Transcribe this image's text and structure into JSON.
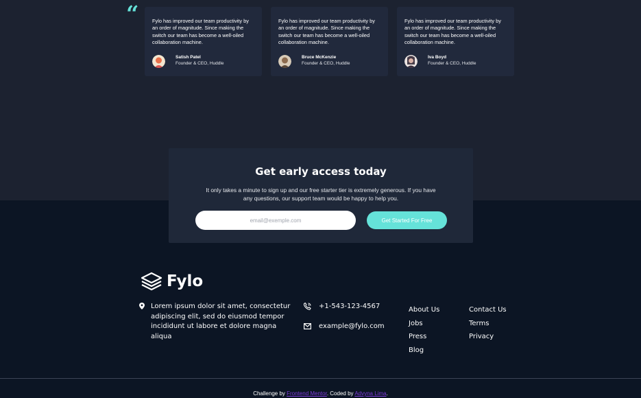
{
  "testimonials": {
    "quote_glyph": "“",
    "cards": [
      {
        "text": "Fylo has improved our team productivity by an order of magnitude. Since making the switch our team has become a well-oiled collaboration machine.",
        "name": "Satish Patel",
        "role": "Founder & CEO, Huddle",
        "avatar_color": "#e8704a"
      },
      {
        "text": "Fylo has improved our team productivity by an order of magnitude. Since making the switch our team has become a well-oiled collaboration machine.",
        "name": "Bruce McKenzie",
        "role": "Founder & CEO, Huddle",
        "avatar_color": "#b08a6a"
      },
      {
        "text": "Fylo has improved our team productivity by an order of magnitude. Since making the switch our team has become a well-oiled collaboration machine.",
        "name": "Iva Boyd",
        "role": "Founder & CEO, Huddle",
        "avatar_color": "#c9a3a8"
      }
    ]
  },
  "cta": {
    "title": "Get early access today",
    "body": "It only takes a minute to sign up and our free starter tier is extremely generous. If you have any questions, our support team would be happy to help you.",
    "email_placeholder": "email@exemple.com",
    "button_label": "Get Started For Free"
  },
  "footer": {
    "logo_text": "Fylo",
    "address": "Lorem ipsum dolor sit amet, consectetur adipiscing elit, sed do eiusmod tempor incididunt ut labore et dolore magna aliqua",
    "phone": "+1-543-123-4567",
    "email": "example@fylo.com",
    "links_col1": [
      "About Us",
      "Jobs",
      "Press",
      "Blog"
    ],
    "links_col2": [
      "Contact Us",
      "Terms",
      "Privacy"
    ]
  },
  "attribution": {
    "prefix": "Challenge by ",
    "link1": "Frontend Mentor",
    "middle": ". Coded by ",
    "link2": "Advyna Lima",
    "suffix": "."
  },
  "colors": {
    "accent": "#65e2d9",
    "top_bg": "#1c2230",
    "bottom_bg": "#0c1524",
    "card_bg": "#21293c",
    "link_purple": "#7b3bd6"
  }
}
